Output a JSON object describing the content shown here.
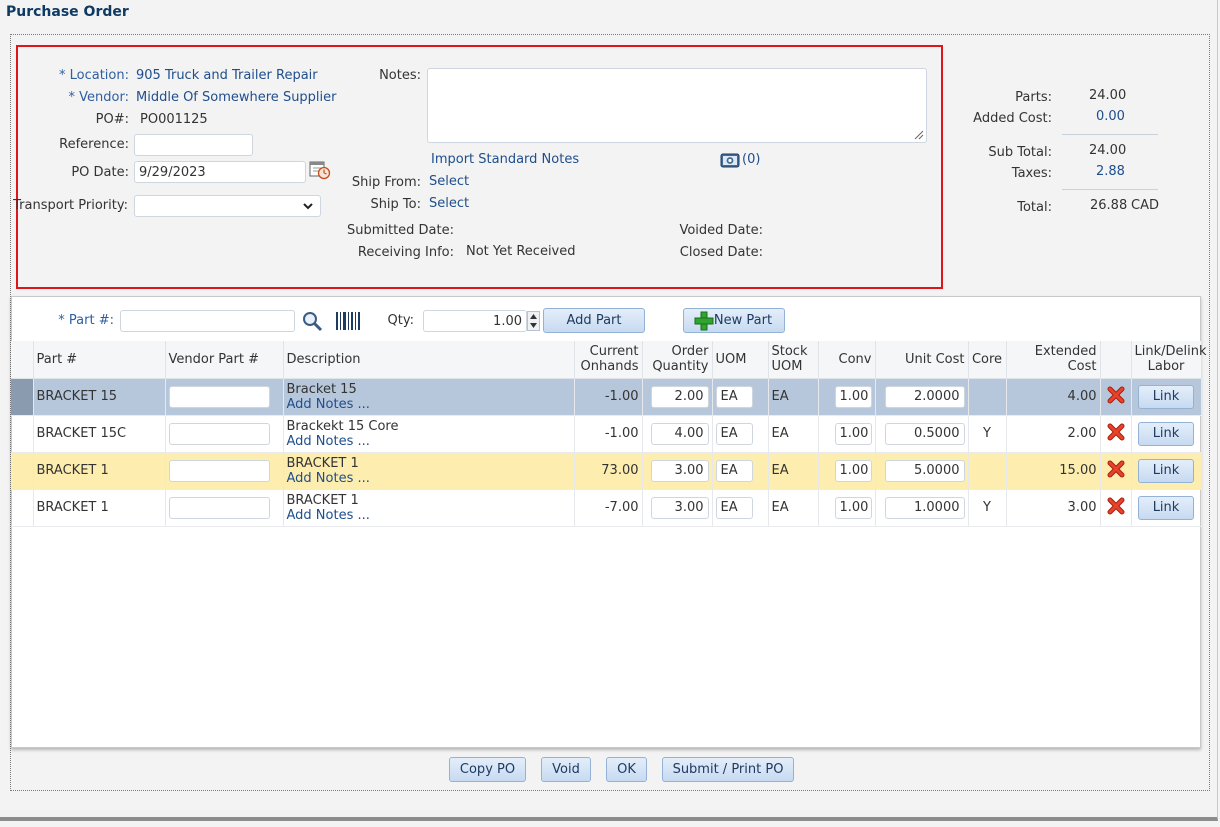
{
  "page": {
    "title": "Purchase Order"
  },
  "header": {
    "location_label": "* Location:",
    "location_value": "905 Truck and Trailer Repair",
    "vendor_label": "* Vendor:",
    "vendor_value": "Middle Of Somewhere Supplier",
    "po_label": "PO#:",
    "po_value": "PO001125",
    "reference_label": "Reference:",
    "reference_value": "",
    "po_date_label": "PO Date:",
    "po_date_value": "9/29/2023",
    "transport_priority_label": "Transport Priority:",
    "transport_priority_value": "",
    "notes_label": "Notes:",
    "notes_value": "",
    "import_notes_label": "Import Standard Notes",
    "attachments_count": "(0)",
    "ship_from_label": "Ship From:",
    "ship_from_value": "Select",
    "ship_to_label": "Ship To:",
    "ship_to_value": "Select",
    "submitted_date_label": "Submitted Date:",
    "voided_date_label": "Voided Date:",
    "receiving_info_label": "Receiving Info:",
    "receiving_info_value": "Not Yet Received",
    "closed_date_label": "Closed Date:"
  },
  "summary": {
    "parts_label": "Parts:",
    "parts_value": "24.00",
    "added_cost_label": "Added Cost:",
    "added_cost_value": "0.00",
    "subtotal_label": "Sub Total:",
    "subtotal_value": "24.00",
    "taxes_label": "Taxes:",
    "taxes_value": "2.88",
    "total_label": "Total:",
    "total_value": "26.88",
    "currency": "CAD"
  },
  "part_entry": {
    "part_label": "* Part #:",
    "part_value": "",
    "qty_label": "Qty:",
    "qty_value": "1.00",
    "add_part_label": "Add Part",
    "new_part_label": "New Part"
  },
  "table": {
    "headers": {
      "part": "Part #",
      "vendor_part": "Vendor Part #",
      "description": "Description",
      "onhands_1": "Current",
      "onhands_2": "Onhands",
      "order_qty_1": "Order",
      "order_qty_2": "Quantity",
      "uom": "UOM",
      "stock_uom_1": "Stock",
      "stock_uom_2": "UOM",
      "conv": "Conv",
      "unit_cost": "Unit Cost",
      "core": "Core",
      "extended_cost": "Extended Cost",
      "link_1": "Link/Delink",
      "link_2": "Labor"
    },
    "rows": [
      {
        "part": "BRACKET 15",
        "vendor_part": "",
        "description": "Bracket 15",
        "notes": "Add Notes ...",
        "onhands": "-1.00",
        "order_qty": "2.00",
        "uom": "EA",
        "stock_uom": "EA",
        "conv": "1.00",
        "unit_cost": "2.0000",
        "core": "",
        "extended": "4.00",
        "link": "Link"
      },
      {
        "part": "BRACKET 15C",
        "vendor_part": "",
        "description": "Brackekt 15 Core",
        "notes": "Add Notes ...",
        "onhands": "-1.00",
        "order_qty": "4.00",
        "uom": "EA",
        "stock_uom": "EA",
        "conv": "1.00",
        "unit_cost": "0.5000",
        "core": "Y",
        "extended": "2.00",
        "link": "Link"
      },
      {
        "part": "BRACKET 1",
        "vendor_part": "",
        "description": "BRACKET 1",
        "notes": "Add Notes ...",
        "onhands": "73.00",
        "order_qty": "3.00",
        "uom": "EA",
        "stock_uom": "EA",
        "conv": "1.00",
        "unit_cost": "5.0000",
        "core": "",
        "extended": "15.00",
        "link": "Link"
      },
      {
        "part": "BRACKET 1",
        "vendor_part": "",
        "description": "BRACKET 1",
        "notes": "Add Notes ...",
        "onhands": "-7.00",
        "order_qty": "3.00",
        "uom": "EA",
        "stock_uom": "EA",
        "conv": "1.00",
        "unit_cost": "1.0000",
        "core": "Y",
        "extended": "3.00",
        "link": "Link"
      }
    ]
  },
  "footer": {
    "copy_po": "Copy PO",
    "void": "Void",
    "ok": "OK",
    "submit_print": "Submit / Print PO"
  },
  "colors": {
    "accent_link": "#1f4e8c",
    "header_highlight_border": "#e0141b",
    "selected_row": "#b7c7db",
    "highlight_row": "#fdeeb0",
    "delete_icon": "#d9301c",
    "new_part_plus": "#2fa52f"
  },
  "icons": {
    "calendar": "calendar-clock-icon",
    "camera": "camera-icon",
    "search": "search-icon",
    "barcode": "barcode-icon",
    "delete": "delete-x-icon",
    "plus": "plus-icon",
    "chevron": "chevron-down-icon"
  }
}
